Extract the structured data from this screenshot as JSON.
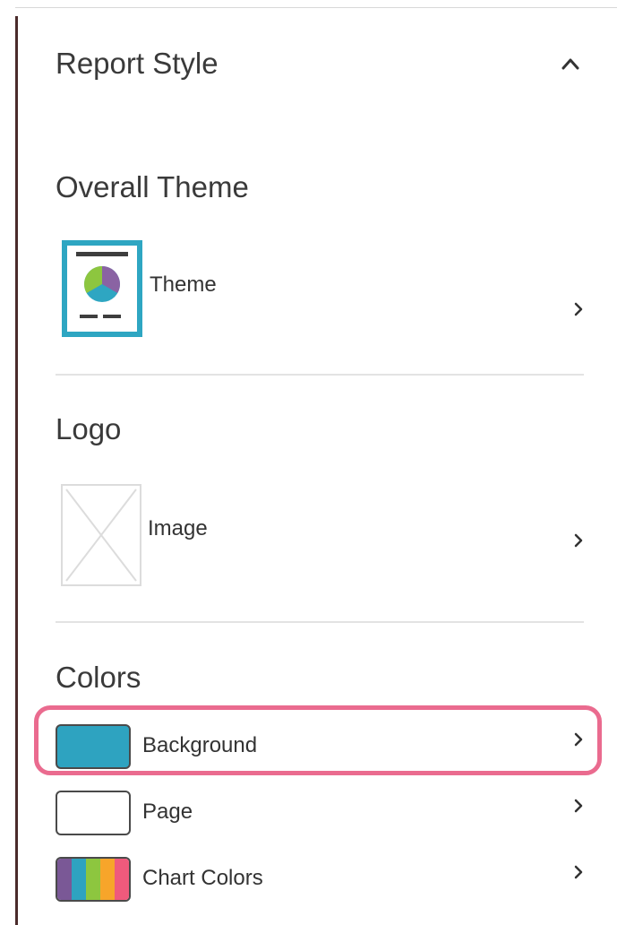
{
  "panel": {
    "title": "Report Style"
  },
  "sections": {
    "overall_theme": {
      "heading": "Overall Theme",
      "row_label": "Theme"
    },
    "logo": {
      "heading": "Logo",
      "row_label": "Image"
    },
    "colors": {
      "heading": "Colors",
      "rows": [
        {
          "label": "Background",
          "swatch_color": "#2ea3c0",
          "highlighted": true
        },
        {
          "label": "Page",
          "swatch_color": "#ffffff",
          "highlighted": false
        },
        {
          "label": "Chart Colors",
          "swatch_colors": [
            "#7a5896",
            "#2ea3c0",
            "#8dc63f",
            "#f7a52a",
            "#ef5a7c"
          ],
          "highlighted": false
        }
      ]
    }
  },
  "colors": {
    "accent_teal": "#2ea6c2",
    "highlight_pink": "#ea6b8f",
    "pie_purple": "#8a63a3",
    "pie_green": "#8dc63f",
    "pie_blue": "#2ea6c2"
  },
  "icons": {
    "collapse": "chevron-up-icon",
    "row_chevron": "chevron-right-icon"
  }
}
